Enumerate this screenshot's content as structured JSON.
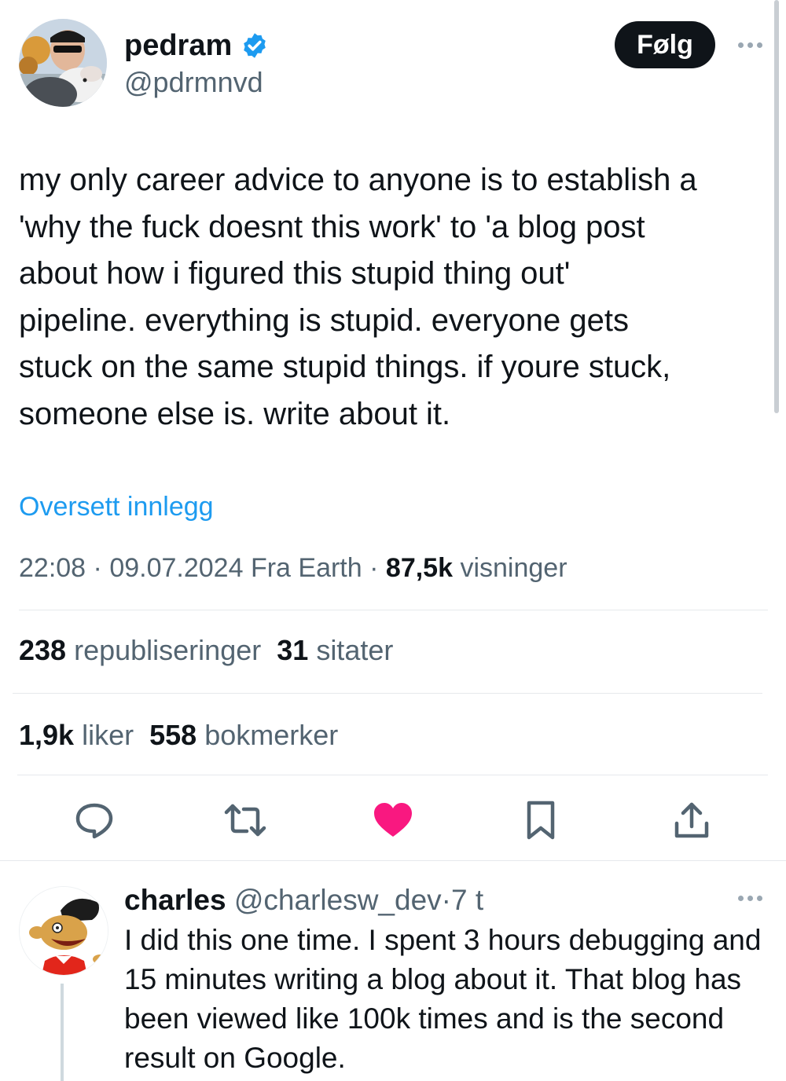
{
  "author": {
    "name": "pedram",
    "handle": "@pdrmnvd",
    "follow_label": "Følg"
  },
  "tweet": {
    "text": "my only career advice to anyone is to establish a\n'why the fuck doesnt this work' to 'a blog post\nabout how i figured this stupid thing out'\npipeline. everything is stupid. everyone gets\nstuck on the same stupid things. if youre stuck,\nsomeone else is. write about it.",
    "translate_label": "Oversett innlegg",
    "time": "22:08",
    "date": "09.07.2024",
    "location": "Fra Earth",
    "views_count": "87,5k",
    "views_label": "visninger"
  },
  "stats": {
    "reposts_count": "238",
    "reposts_label": "republiseringer",
    "quotes_count": "31",
    "quotes_label": "sitater",
    "likes_count": "1,9k",
    "likes_label": "liker",
    "bookmarks_count": "558",
    "bookmarks_label": "bokmerker"
  },
  "actions": [
    "reply-icon",
    "repost-icon",
    "like-icon",
    "bookmark-icon",
    "share-icon"
  ],
  "reply": {
    "name": "charles",
    "handle": "@charlesw_dev",
    "time": "7 t",
    "text": "I did this one time. I spent 3 hours debugging and 15 minutes writing a blog about it. That blog has been viewed like 100k times and is the second result on Google."
  },
  "colors": {
    "link": "#1d9bf0",
    "like_active": "#f91880",
    "verified": "#1d9bf0",
    "secondary_text": "#536471",
    "icon": "#536471"
  }
}
